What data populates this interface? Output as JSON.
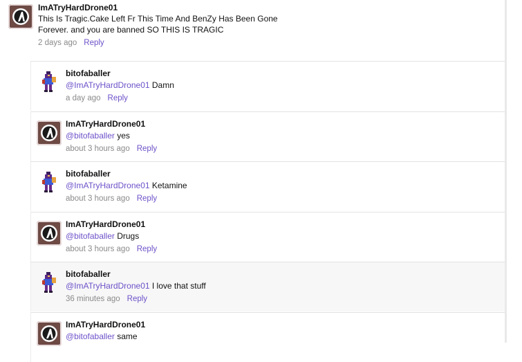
{
  "thread": {
    "parent": {
      "author": "ImATryHardDrone01",
      "avatar_icon": "drone-logo-icon",
      "text": "This Is Tragic.Cake Left Fr This Time And BenZy Has Been Gone Forever. and you are banned SO THIS IS TRAGIC",
      "time": "2 days ago",
      "reply_label": "Reply"
    },
    "replies": [
      {
        "author": "bitofaballer",
        "avatar_icon": "pixel-character-icon",
        "mention": "@ImATryHardDrone01",
        "text": " Damn",
        "time": "a day ago",
        "reply_label": "Reply"
      },
      {
        "author": "ImATryHardDrone01",
        "avatar_icon": "drone-logo-icon",
        "mention": "@bitofaballer",
        "text": " yes",
        "time": "about 3 hours ago",
        "reply_label": "Reply"
      },
      {
        "author": "bitofaballer",
        "avatar_icon": "pixel-character-icon",
        "mention": "@ImATryHardDrone01",
        "text": " Ketamine",
        "time": "about 3 hours ago",
        "reply_label": "Reply"
      },
      {
        "author": "ImATryHardDrone01",
        "avatar_icon": "drone-logo-icon",
        "mention": "@bitofaballer",
        "text": " Drugs",
        "time": "about 3 hours ago",
        "reply_label": "Reply"
      },
      {
        "author": "bitofaballer",
        "avatar_icon": "pixel-character-icon",
        "mention": "@ImATryHardDrone01",
        "text": " I love that stuff",
        "time": "36 minutes ago",
        "reply_label": "Reply"
      },
      {
        "author": "ImATryHardDrone01",
        "avatar_icon": "drone-logo-icon",
        "mention": "@bitofaballer",
        "text": " same",
        "time": "",
        "reply_label": ""
      }
    ]
  },
  "colors": {
    "link": "#6d51c9",
    "meta": "#8a8a8a",
    "avatar": "#6e4a45"
  }
}
